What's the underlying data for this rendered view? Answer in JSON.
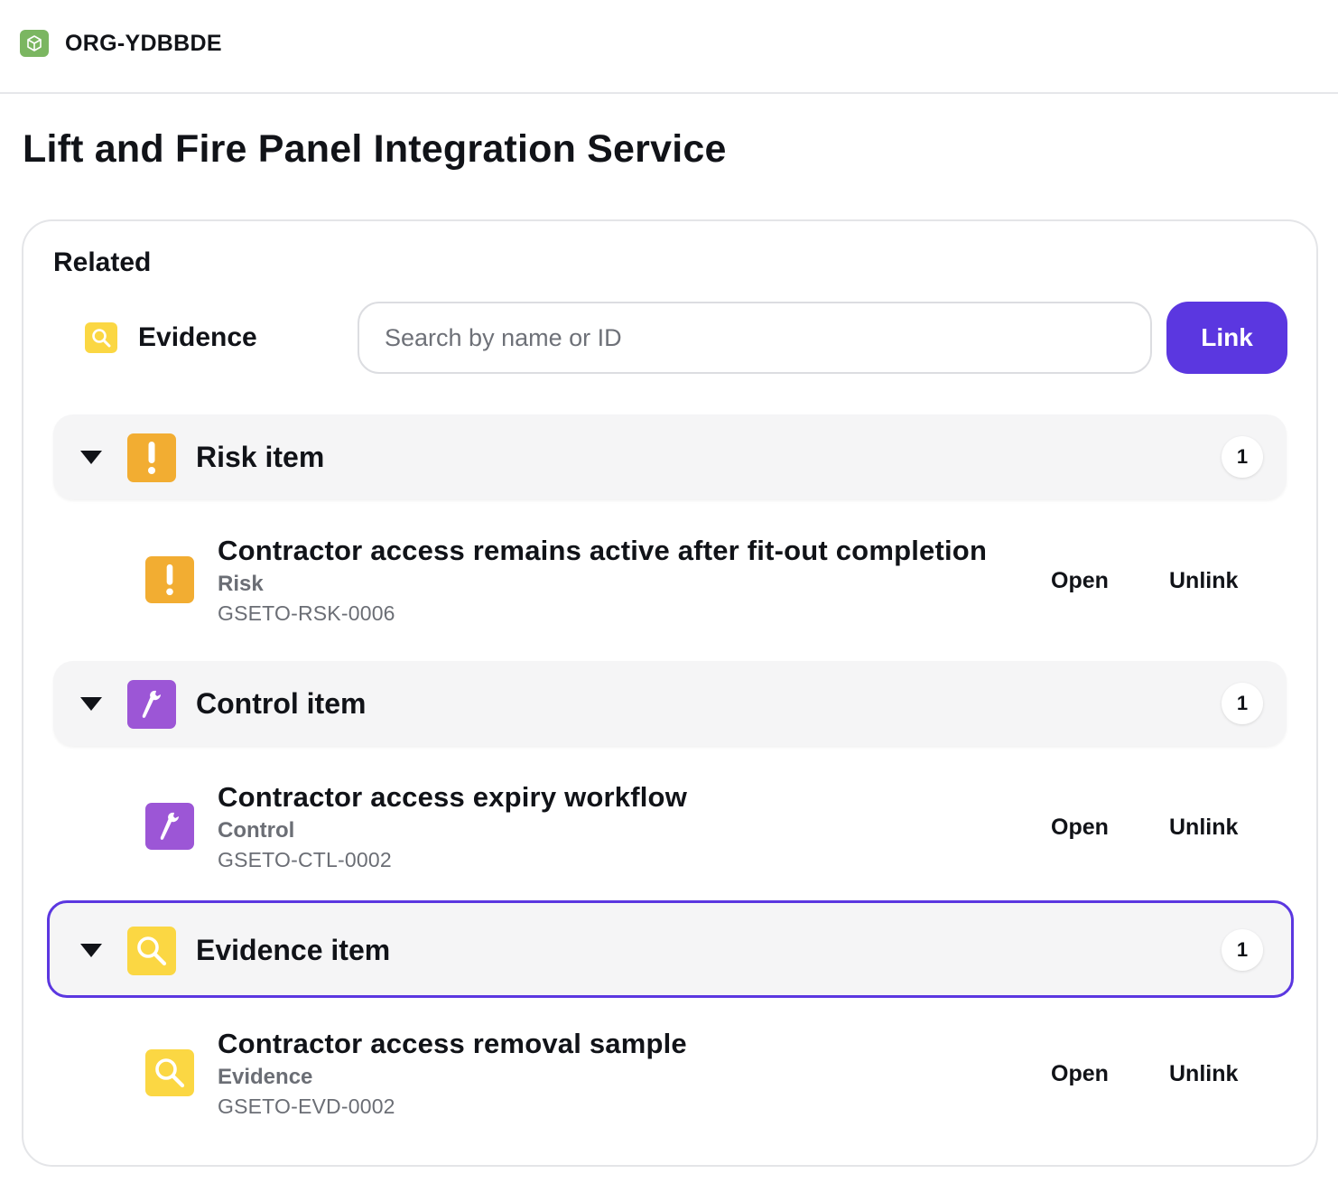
{
  "org": {
    "name": "ORG-YDBBDE",
    "logo_icon": "cube-icon",
    "logo_color": "#7bb661"
  },
  "page": {
    "title": "Lift and Fire Panel Integration Service"
  },
  "related": {
    "heading": "Related",
    "link_type": {
      "label": "Evidence",
      "icon": "magnifier-icon"
    },
    "search": {
      "placeholder": "Search by name or ID",
      "value": ""
    },
    "link_button": "Link",
    "accent_color": "#5b37e0"
  },
  "groups": [
    {
      "title": "Risk item",
      "count": "1",
      "icon": "exclamation-icon",
      "color": "#f2ad32",
      "expanded": true,
      "items": [
        {
          "title": "Contractor access remains active after fit-out completion",
          "type": "Risk",
          "id": "GSETO-RSK-0006",
          "open_label": "Open",
          "unlink_label": "Unlink"
        }
      ]
    },
    {
      "title": "Control item",
      "count": "1",
      "icon": "wrench-icon",
      "color": "#9c56d6",
      "expanded": true,
      "items": [
        {
          "title": "Contractor access expiry workflow",
          "type": "Control",
          "id": "GSETO-CTL-0002",
          "open_label": "Open",
          "unlink_label": "Unlink"
        }
      ]
    },
    {
      "title": "Evidence item",
      "count": "1",
      "icon": "magnifier-icon",
      "color": "#fbd743",
      "expanded": true,
      "focused": true,
      "items": [
        {
          "title": "Contractor access removal sample",
          "type": "Evidence",
          "id": "GSETO-EVD-0002",
          "open_label": "Open",
          "unlink_label": "Unlink"
        }
      ]
    }
  ]
}
